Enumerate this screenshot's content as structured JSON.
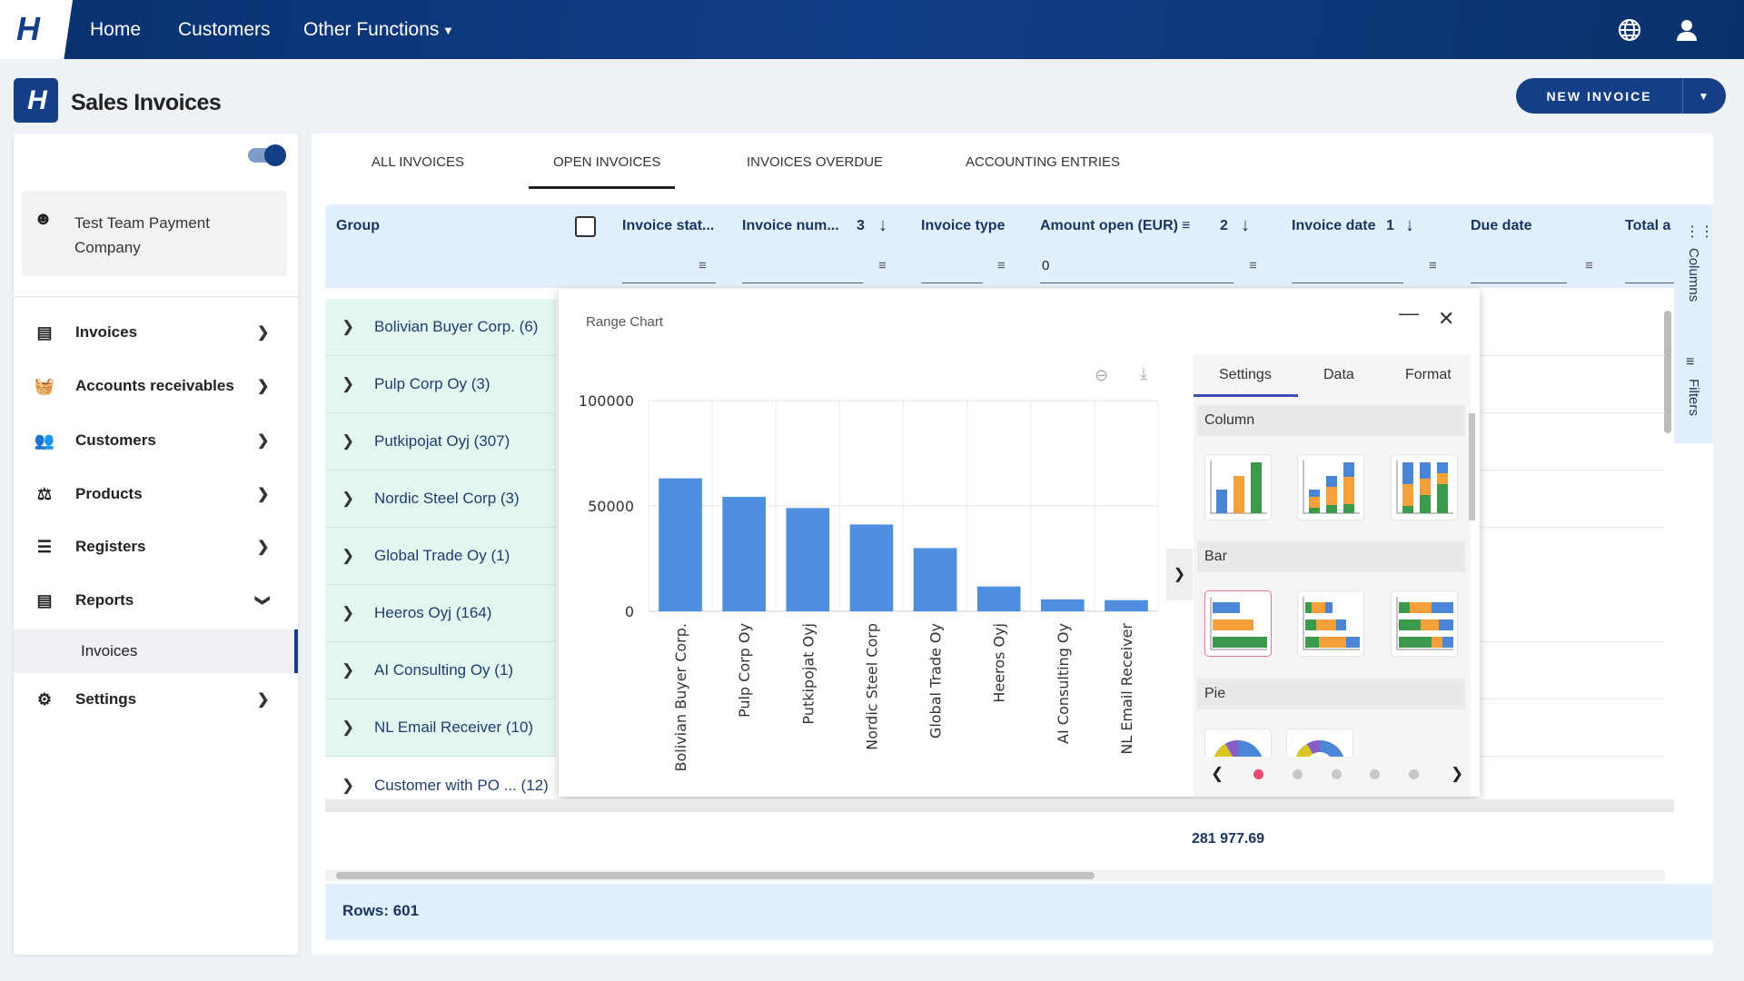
{
  "nav": {
    "home": "Home",
    "customers": "Customers",
    "other": "Other Functions",
    "globe_icon": "globe-icon",
    "user_icon": "user-icon"
  },
  "header": {
    "title": "Sales Invoices",
    "new_invoice": "NEW INVOICE"
  },
  "sidebar": {
    "company": "Test Team Payment Company",
    "items": [
      {
        "label": "Invoices",
        "icon": "document-icon"
      },
      {
        "label": "Accounts receivables",
        "icon": "basket-icon"
      },
      {
        "label": "Customers",
        "icon": "people-icon"
      },
      {
        "label": "Products",
        "icon": "product-icon"
      },
      {
        "label": "Registers",
        "icon": "list-icon"
      },
      {
        "label": "Reports",
        "icon": "report-icon"
      },
      {
        "label": "Settings",
        "icon": "gear-icon"
      }
    ],
    "subitem": "Invoices"
  },
  "tabs": [
    "ALL INVOICES",
    "OPEN INVOICES",
    "INVOICES OVERDUE",
    "ACCOUNTING ENTRIES"
  ],
  "active_tab": "OPEN INVOICES",
  "grid": {
    "columns": [
      "Group",
      "Invoice stat...",
      "Invoice num...",
      "Invoice type",
      "Amount open (EUR)",
      "Invoice date",
      "Due date",
      "Total a"
    ],
    "sort_invoice_num": "3",
    "sort_amount": "2",
    "sort_invoice_date": "1",
    "amount_filter": "0",
    "groups": [
      "Bolivian Buyer Corp. (6)",
      "Pulp Corp Oy (3)",
      "Putkipojat Oyj (307)",
      "Nordic Steel Corp (3)",
      "Global Trade Oy (1)",
      "Heeros Oyj (164)",
      "AI Consulting Oy (1)",
      "NL Email Receiver (10)",
      "Customer with PO ...  (12)"
    ],
    "total": "281 977.69",
    "rows": "Rows: 601",
    "side_columns": "Columns",
    "side_filters": "Filters"
  },
  "dialog": {
    "title": "Range Chart",
    "tabs": [
      "Settings",
      "Data",
      "Format"
    ],
    "sections": [
      "Column",
      "Bar",
      "Pie"
    ]
  },
  "colors": {
    "nav": "#0f3a80",
    "bar": "#4f8fdf",
    "accent": "#143e86",
    "group_bg": "#e3f6ef",
    "active_dot": "#e94b6e"
  },
  "chart_data": {
    "type": "bar",
    "categories": [
      "Bolivian Buyer Corp.",
      "Pulp Corp Oy",
      "Putkipojat Oyj",
      "Nordic Steel Corp",
      "Global Trade Oy",
      "Heeros Oyj",
      "AI Consulting Oy",
      "NL Email Receiver"
    ],
    "values": [
      63100,
      54300,
      49000,
      41200,
      30000,
      11800,
      5700,
      5300
    ],
    "yticks": [
      "0",
      "50000",
      "100000"
    ],
    "ylim": [
      0,
      100000
    ],
    "grid": true
  }
}
